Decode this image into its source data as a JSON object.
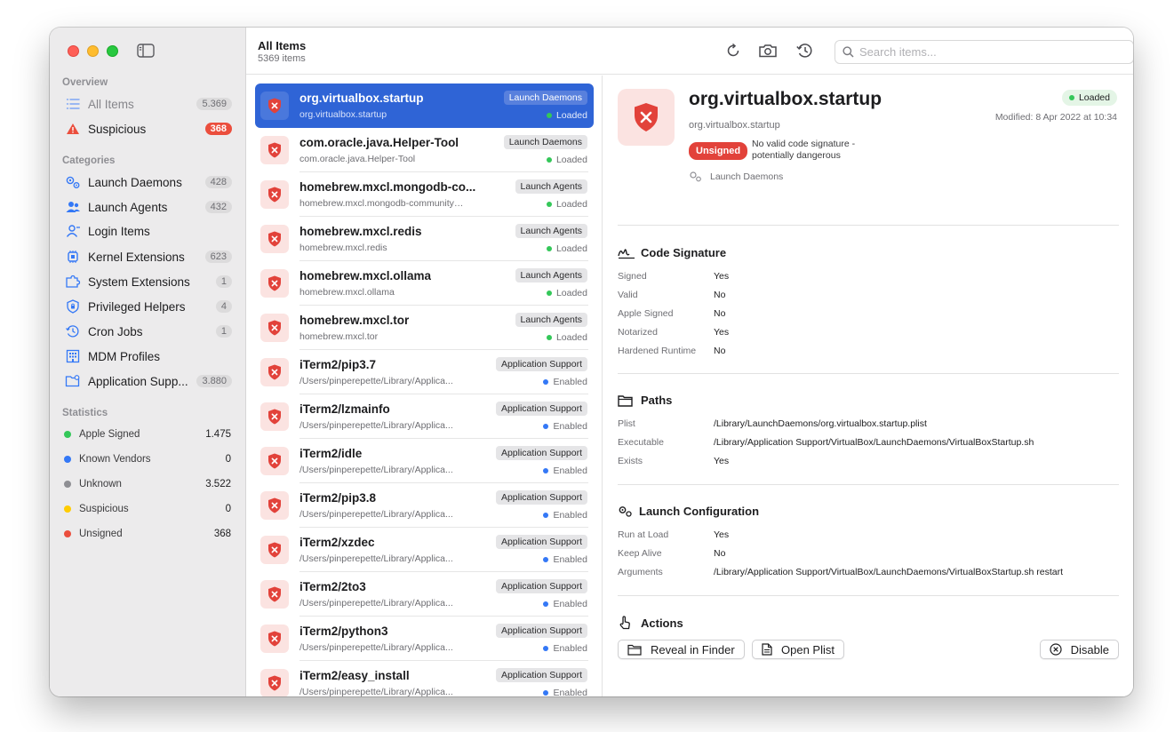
{
  "sidebar": {
    "sections": {
      "overview": "Overview",
      "categories": "Categories",
      "statistics": "Statistics"
    },
    "overview": [
      {
        "label": "All Items",
        "count": "5.369",
        "icon": "list-icon"
      },
      {
        "label": "Suspicious",
        "count": "368",
        "icon": "warning-icon"
      }
    ],
    "categories": [
      {
        "label": "Launch Daemons",
        "count": "428",
        "icon": "gears-icon"
      },
      {
        "label": "Launch Agents",
        "count": "432",
        "icon": "person-group-icon"
      },
      {
        "label": "Login Items",
        "count": "",
        "icon": "person-icon"
      },
      {
        "label": "Kernel Extensions",
        "count": "623",
        "icon": "chip-icon"
      },
      {
        "label": "System Extensions",
        "count": "1",
        "icon": "puzzle-icon"
      },
      {
        "label": "Privileged Helpers",
        "count": "4",
        "icon": "shield-lock-icon"
      },
      {
        "label": "Cron Jobs",
        "count": "1",
        "icon": "clock-icon"
      },
      {
        "label": "MDM Profiles",
        "count": "",
        "icon": "building-icon"
      },
      {
        "label": "Application Supp...",
        "count": "3.880",
        "icon": "folder-gear-icon"
      }
    ],
    "statistics": [
      {
        "label": "Apple Signed",
        "value": "1.475",
        "color": "#34c759"
      },
      {
        "label": "Known Vendors",
        "value": "0",
        "color": "#3478f6"
      },
      {
        "label": "Unknown",
        "value": "3.522",
        "color": "#8e8e93"
      },
      {
        "label": "Suspicious",
        "value": "0",
        "color": "#ffcc00"
      },
      {
        "label": "Unsigned",
        "value": "368",
        "color": "#eb4e3d"
      }
    ]
  },
  "toolbar": {
    "title": "All Items",
    "subtitle": "5369 items",
    "search_placeholder": "Search items..."
  },
  "colors": {
    "accent": "#2f64d6",
    "danger": "#e2423a",
    "loaded": "#34c759",
    "enabled": "#3478f6"
  },
  "list": [
    {
      "name": "org.virtualbox.startup",
      "sub": "org.virtualbox.startup",
      "tag": "Launch Daemons",
      "status": "Loaded",
      "status_color": "#34c759",
      "selected": true
    },
    {
      "name": "com.oracle.java.Helper-Tool",
      "sub": "com.oracle.java.Helper-Tool",
      "tag": "Launch Daemons",
      "status": "Loaded",
      "status_color": "#34c759"
    },
    {
      "name": "homebrew.mxcl.mongodb-co...",
      "sub": "homebrew.mxcl.mongodb-community@4...",
      "tag": "Launch Agents",
      "status": "Loaded",
      "status_color": "#34c759"
    },
    {
      "name": "homebrew.mxcl.redis",
      "sub": "homebrew.mxcl.redis",
      "tag": "Launch Agents",
      "status": "Loaded",
      "status_color": "#34c759"
    },
    {
      "name": "homebrew.mxcl.ollama",
      "sub": "homebrew.mxcl.ollama",
      "tag": "Launch Agents",
      "status": "Loaded",
      "status_color": "#34c759"
    },
    {
      "name": "homebrew.mxcl.tor",
      "sub": "homebrew.mxcl.tor",
      "tag": "Launch Agents",
      "status": "Loaded",
      "status_color": "#34c759"
    },
    {
      "name": "iTerm2/pip3.7",
      "sub": "/Users/pinperepette/Library/Applica...",
      "tag": "Application Support",
      "status": "Enabled",
      "status_color": "#3478f6"
    },
    {
      "name": "iTerm2/lzmainfo",
      "sub": "/Users/pinperepette/Library/Applica...",
      "tag": "Application Support",
      "status": "Enabled",
      "status_color": "#3478f6"
    },
    {
      "name": "iTerm2/idle",
      "sub": "/Users/pinperepette/Library/Applica...",
      "tag": "Application Support",
      "status": "Enabled",
      "status_color": "#3478f6"
    },
    {
      "name": "iTerm2/pip3.8",
      "sub": "/Users/pinperepette/Library/Applica...",
      "tag": "Application Support",
      "status": "Enabled",
      "status_color": "#3478f6"
    },
    {
      "name": "iTerm2/xzdec",
      "sub": "/Users/pinperepette/Library/Applica...",
      "tag": "Application Support",
      "status": "Enabled",
      "status_color": "#3478f6"
    },
    {
      "name": "iTerm2/2to3",
      "sub": "/Users/pinperepette/Library/Applica...",
      "tag": "Application Support",
      "status": "Enabled",
      "status_color": "#3478f6"
    },
    {
      "name": "iTerm2/python3",
      "sub": "/Users/pinperepette/Library/Applica...",
      "tag": "Application Support",
      "status": "Enabled",
      "status_color": "#3478f6"
    },
    {
      "name": "iTerm2/easy_install",
      "sub": "/Users/pinperepette/Library/Applica...",
      "tag": "Application Support",
      "status": "Enabled",
      "status_color": "#3478f6"
    }
  ],
  "detail": {
    "title": "org.virtualbox.startup",
    "subtitle": "org.virtualbox.startup",
    "status": "Loaded",
    "modified": "Modified: 8 Apr 2022 at 10:34",
    "unsigned_label": "Unsigned",
    "unsigned_note": "No valid code signature - potentially dangerous",
    "category": "Launch Daemons",
    "code_signature": {
      "title": "Code Signature",
      "rows": [
        {
          "k": "Signed",
          "v": "Yes"
        },
        {
          "k": "Valid",
          "v": "No"
        },
        {
          "k": "Apple Signed",
          "v": "No"
        },
        {
          "k": "Notarized",
          "v": "Yes"
        },
        {
          "k": "Hardened Runtime",
          "v": "No"
        }
      ]
    },
    "paths": {
      "title": "Paths",
      "rows": [
        {
          "k": "Plist",
          "v": "/Library/LaunchDaemons/org.virtualbox.startup.plist"
        },
        {
          "k": "Executable",
          "v": "/Library/Application Support/VirtualBox/LaunchDaemons/VirtualBoxStartup.sh"
        },
        {
          "k": "Exists",
          "v": "Yes"
        }
      ]
    },
    "launch_config": {
      "title": "Launch Configuration",
      "rows": [
        {
          "k": "Run at Load",
          "v": "Yes"
        },
        {
          "k": "Keep Alive",
          "v": "No"
        },
        {
          "k": "Arguments",
          "v": "/Library/Application Support/VirtualBox/LaunchDaemons/VirtualBoxStartup.sh restart"
        }
      ]
    },
    "actions": {
      "title": "Actions",
      "reveal": "Reveal in Finder",
      "open_plist": "Open Plist",
      "disable": "Disable"
    }
  }
}
